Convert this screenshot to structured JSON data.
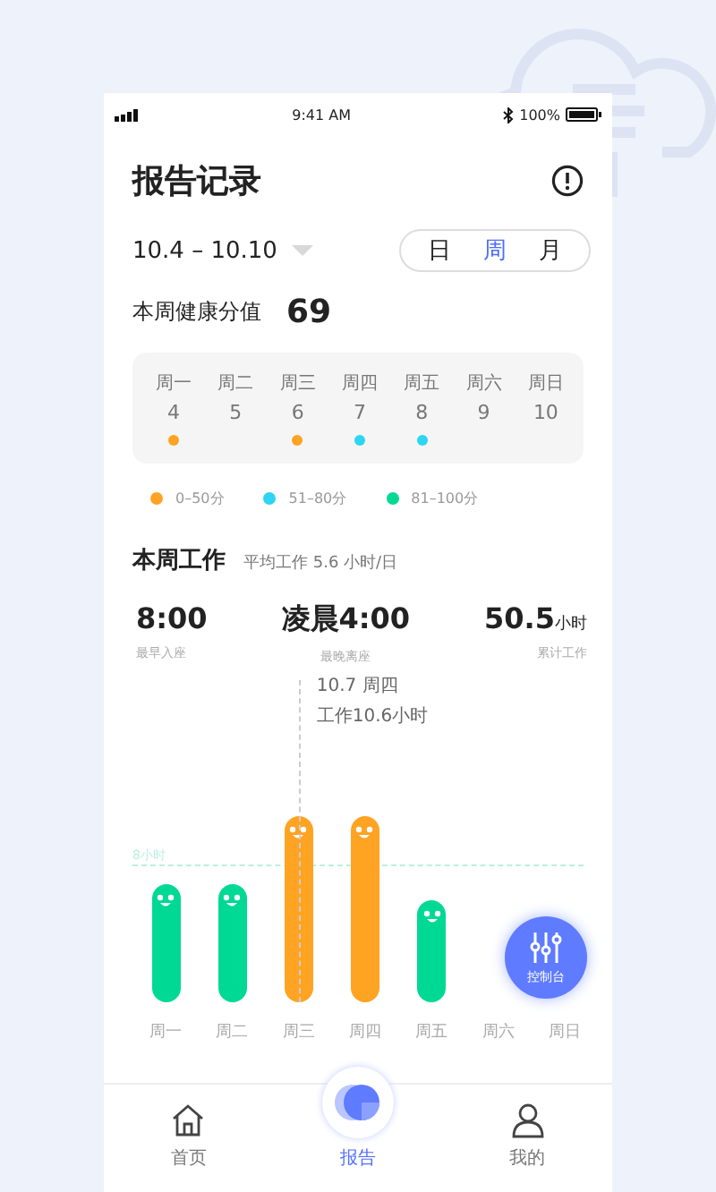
{
  "status_bar": {
    "time": "9:41 AM",
    "battery": "100%"
  },
  "header": {
    "title": "报告记录"
  },
  "date_range": {
    "label": "10.4 – 10.10"
  },
  "period_tabs": [
    {
      "label": "日",
      "selected": false
    },
    {
      "label": "周",
      "selected": true
    },
    {
      "label": "月",
      "selected": false
    }
  ],
  "health": {
    "label": "本周健康分值",
    "score": "69"
  },
  "calendar": [
    {
      "weekday": "周一",
      "date": "4",
      "color": "#ffa323"
    },
    {
      "weekday": "周二",
      "date": "5"
    },
    {
      "weekday": "周三",
      "date": "6",
      "color": "#ffa323"
    },
    {
      "weekday": "周四",
      "date": "7",
      "color": "#2dd5f2"
    },
    {
      "weekday": "周五",
      "date": "8",
      "color": "#2dd5f2"
    },
    {
      "weekday": "周六",
      "date": "9"
    },
    {
      "weekday": "周日",
      "date": "10"
    }
  ],
  "legend": [
    {
      "label": "0–50分",
      "color": "#ffa323"
    },
    {
      "label": "51–80分",
      "color": "#2dd5f2"
    },
    {
      "label": "81–100分",
      "color": "#00d993"
    }
  ],
  "work": {
    "title": "本周工作",
    "average": "平均工作 5.6 小时/日",
    "stats": [
      {
        "value": "8:00",
        "label": "最早入座"
      },
      {
        "value": "凌晨4:00",
        "label": "最晚离座"
      },
      {
        "value": "50.5",
        "unit": "小时",
        "label": "累计工作"
      }
    ]
  },
  "chart": {
    "reference_label": "8小时",
    "tooltip": [
      "10.7 周四",
      "工作10.6小时"
    ],
    "bars": [
      {
        "label": "周一",
        "kind": "medium",
        "color": "#00d993",
        "selected": false
      },
      {
        "label": "周二",
        "kind": "medium",
        "color": "#00d993",
        "selected": false
      },
      {
        "label": "周三",
        "kind": "tall",
        "color": "#ffa323",
        "selected": true
      },
      {
        "label": "周四",
        "kind": "tall",
        "color": "#ffa323",
        "selected": false
      },
      {
        "label": "周五",
        "kind": "short",
        "color": "#00d993",
        "selected": false
      },
      {
        "label": "周六",
        "selected": false
      },
      {
        "label": "周日",
        "selected": false
      }
    ]
  },
  "fab": {
    "label": "控制台"
  },
  "nav": [
    {
      "label": "首页",
      "kind": "home",
      "selected": false
    },
    {
      "label": "报告",
      "kind": "report",
      "selected": true
    },
    {
      "label": "我的",
      "kind": "profile",
      "selected": false
    }
  ]
}
